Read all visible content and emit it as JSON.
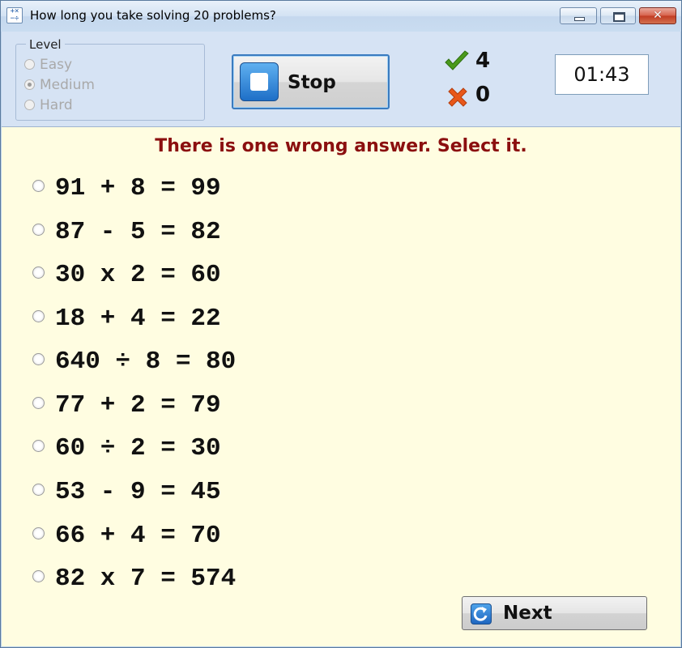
{
  "window": {
    "title": "How long you take solving 20 problems?",
    "close_glyph": "✕"
  },
  "level": {
    "legend": "Level",
    "options": [
      {
        "label": "Easy",
        "selected": false,
        "enabled": false
      },
      {
        "label": "Medium",
        "selected": true,
        "enabled": false
      },
      {
        "label": "Hard",
        "selected": false,
        "enabled": false
      }
    ]
  },
  "controls": {
    "stop_label": "Stop",
    "next_label": "Next"
  },
  "score": {
    "correct": "4",
    "wrong": "0",
    "correct_color": "#4a9a1c",
    "wrong_color": "#e8581a"
  },
  "timer": "01:43",
  "instruction": "There is one wrong answer. Select it.",
  "problems": [
    "91 + 8 = 99",
    "87 - 5 = 82",
    "30 x 2 = 60",
    "18 + 4 = 22",
    "640 ÷ 8 = 80",
    "77 + 2 = 79",
    "60 ÷ 2 = 30",
    "53 - 9 = 45",
    "66 + 4 = 70",
    "82 x 7 = 574"
  ],
  "icons": {
    "app": "grid-calculator-icon",
    "correct": "checkmark-icon",
    "wrong": "cross-icon",
    "stop": "stop-square-icon",
    "next": "refresh-arrow-icon"
  }
}
